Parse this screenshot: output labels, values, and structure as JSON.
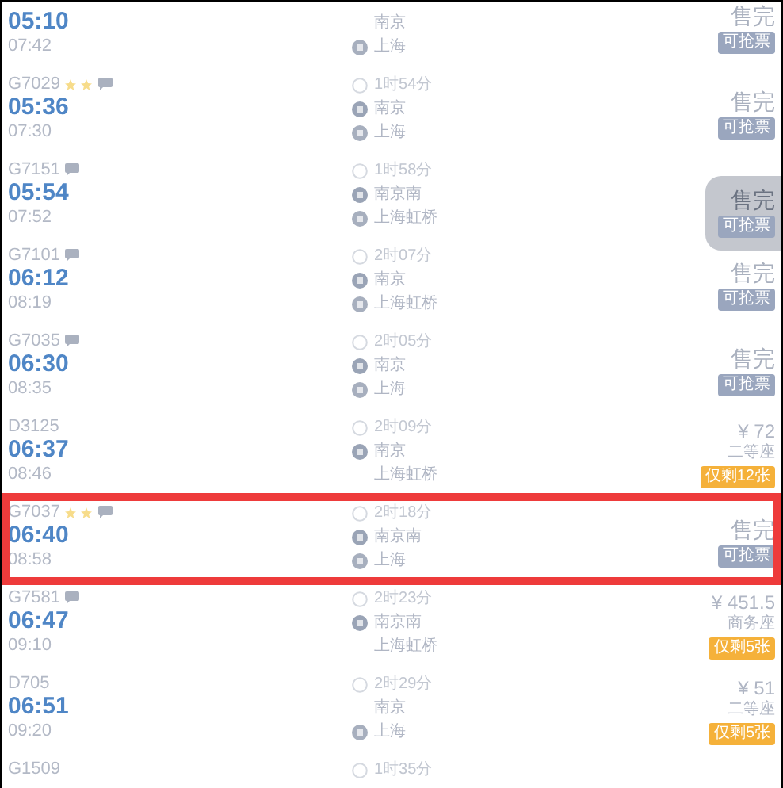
{
  "trains": [
    {
      "depart": "05:10",
      "arrive": "07:42",
      "from": {
        "name": "南京",
        "kind": "start_hidden"
      },
      "to": {
        "name": "上海",
        "kind": "end"
      },
      "status": {
        "kind": "sold_out",
        "label": "售完",
        "tag": "可抢票"
      },
      "marked": false,
      "bubble": false,
      "pressed": false,
      "highlighted": false
    },
    {
      "number": "G7029",
      "depart": "05:36",
      "arrive": "07:30",
      "duration": "1时54分",
      "from": {
        "name": "南京",
        "kind": "start"
      },
      "to": {
        "name": "上海",
        "kind": "end"
      },
      "status": {
        "kind": "sold_out",
        "label": "售完",
        "tag": "可抢票"
      },
      "marked": true,
      "bubble": true,
      "pressed": false,
      "highlighted": false
    },
    {
      "number": "G7151",
      "depart": "05:54",
      "arrive": "07:52",
      "duration": "1时58分",
      "from": {
        "name": "南京南",
        "kind": "start"
      },
      "to": {
        "name": "上海虹桥",
        "kind": "end"
      },
      "status": {
        "kind": "sold_out",
        "label": "售完",
        "tag": "可抢票"
      },
      "marked": false,
      "bubble": true,
      "pressed": true,
      "highlighted": false
    },
    {
      "number": "G7101",
      "depart": "06:12",
      "arrive": "08:19",
      "duration": "2时07分",
      "from": {
        "name": "南京",
        "kind": "start"
      },
      "to": {
        "name": "上海虹桥",
        "kind": "end"
      },
      "status": {
        "kind": "sold_out",
        "label": "售完",
        "tag": "可抢票"
      },
      "marked": false,
      "bubble": true,
      "pressed": false,
      "highlighted": false
    },
    {
      "number": "G7035",
      "depart": "06:30",
      "arrive": "08:35",
      "duration": "2时05分",
      "from": {
        "name": "南京",
        "kind": "start"
      },
      "to": {
        "name": "上海",
        "kind": "end"
      },
      "status": {
        "kind": "sold_out",
        "label": "售完",
        "tag": "可抢票"
      },
      "marked": false,
      "bubble": true,
      "pressed": false,
      "highlighted": false
    },
    {
      "number": "D3125",
      "depart": "06:37",
      "arrive": "08:46",
      "duration": "2时09分",
      "from": {
        "name": "南京",
        "kind": "start"
      },
      "to": {
        "name": "上海虹桥",
        "kind": "pass"
      },
      "status": {
        "kind": "available",
        "price": "¥ 72",
        "seat": "二等座",
        "tag": "仅剩12张"
      },
      "marked": false,
      "bubble": false,
      "highlighted": false
    },
    {
      "number": "G7037",
      "depart": "06:40",
      "arrive": "08:58",
      "duration": "2时18分",
      "from": {
        "name": "南京南",
        "kind": "start"
      },
      "to": {
        "name": "上海",
        "kind": "end"
      },
      "status": {
        "kind": "sold_out",
        "label": "售完",
        "tag": "可抢票"
      },
      "marked": true,
      "bubble": true,
      "pressed": false,
      "highlighted": true
    },
    {
      "number": "G7581",
      "depart": "06:47",
      "arrive": "09:10",
      "duration": "2时23分",
      "from": {
        "name": "南京南",
        "kind": "start"
      },
      "to": {
        "name": "上海虹桥",
        "kind": "pass"
      },
      "status": {
        "kind": "available",
        "price": "¥ 451.5",
        "seat": "商务座",
        "tag": "仅剩5张"
      },
      "marked": false,
      "bubble": true,
      "highlighted": false
    },
    {
      "number": "D705",
      "depart": "06:51",
      "arrive": "09:20",
      "duration": "2时29分",
      "from": {
        "name": "南京",
        "kind": "pass"
      },
      "to": {
        "name": "上海",
        "kind": "end"
      },
      "status": {
        "kind": "available",
        "price": "¥ 51",
        "seat": "二等座",
        "tag": "仅剩5张"
      },
      "marked": false,
      "bubble": false,
      "highlighted": false
    },
    {
      "number": "G1509",
      "duration": "1时35分",
      "marked": false,
      "bubble": false,
      "highlighted": false
    }
  ]
}
